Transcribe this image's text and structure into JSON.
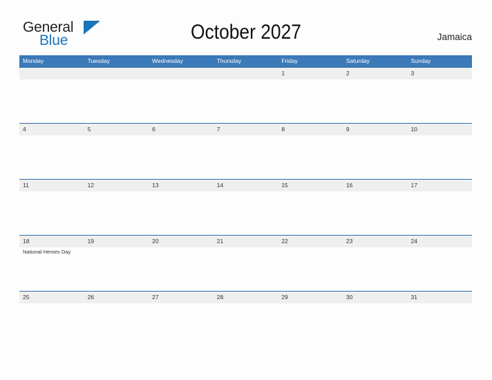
{
  "brand": {
    "name_part1": "General",
    "name_part2": "Blue",
    "flag_color": "#1b75bb"
  },
  "header": {
    "title": "October 2027",
    "country": "Jamaica",
    "header_bg_color": "#3b79b8",
    "date_strip_color": "#efefef"
  },
  "weekdays": [
    "Monday",
    "Tuesday",
    "Wednesday",
    "Thursday",
    "Friday",
    "Saturday",
    "Sunday"
  ],
  "weeks": [
    {
      "days": [
        {
          "date": "",
          "event": ""
        },
        {
          "date": "",
          "event": ""
        },
        {
          "date": "",
          "event": ""
        },
        {
          "date": "",
          "event": ""
        },
        {
          "date": "1",
          "event": ""
        },
        {
          "date": "2",
          "event": ""
        },
        {
          "date": "3",
          "event": ""
        }
      ]
    },
    {
      "days": [
        {
          "date": "4",
          "event": ""
        },
        {
          "date": "5",
          "event": ""
        },
        {
          "date": "6",
          "event": ""
        },
        {
          "date": "7",
          "event": ""
        },
        {
          "date": "8",
          "event": ""
        },
        {
          "date": "9",
          "event": ""
        },
        {
          "date": "10",
          "event": ""
        }
      ]
    },
    {
      "days": [
        {
          "date": "11",
          "event": ""
        },
        {
          "date": "12",
          "event": ""
        },
        {
          "date": "13",
          "event": ""
        },
        {
          "date": "14",
          "event": ""
        },
        {
          "date": "15",
          "event": ""
        },
        {
          "date": "16",
          "event": ""
        },
        {
          "date": "17",
          "event": ""
        }
      ]
    },
    {
      "days": [
        {
          "date": "18",
          "event": "National Heroes Day"
        },
        {
          "date": "19",
          "event": ""
        },
        {
          "date": "20",
          "event": ""
        },
        {
          "date": "21",
          "event": ""
        },
        {
          "date": "22",
          "event": ""
        },
        {
          "date": "23",
          "event": ""
        },
        {
          "date": "24",
          "event": ""
        }
      ]
    },
    {
      "days": [
        {
          "date": "25",
          "event": ""
        },
        {
          "date": "26",
          "event": ""
        },
        {
          "date": "27",
          "event": ""
        },
        {
          "date": "28",
          "event": ""
        },
        {
          "date": "29",
          "event": ""
        },
        {
          "date": "30",
          "event": ""
        },
        {
          "date": "31",
          "event": ""
        }
      ]
    }
  ]
}
